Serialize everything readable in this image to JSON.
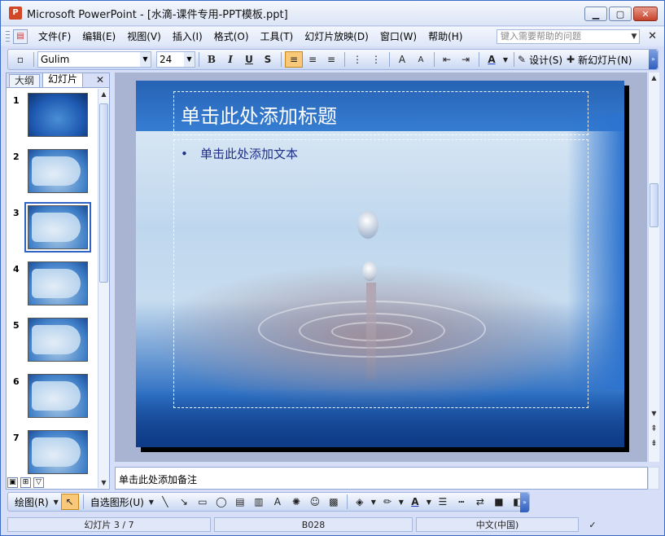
{
  "window": {
    "title": "Microsoft PowerPoint - [水滴-课件专用-PPT模板.ppt]",
    "icon_letter": "P"
  },
  "menu": {
    "items": [
      "文件(F)",
      "编辑(E)",
      "视图(V)",
      "插入(I)",
      "格式(O)",
      "工具(T)",
      "幻灯片放映(D)",
      "窗口(W)",
      "帮助(H)"
    ],
    "help_placeholder": "键入需要帮助的问题"
  },
  "toolbar": {
    "font": "Gulim",
    "size": "24",
    "bold": "B",
    "italic": "I",
    "underline": "U",
    "shadow": "S",
    "design_label": "设计(S)",
    "new_slide_label": "新幻灯片(N)"
  },
  "panel": {
    "tabs": [
      "大纲",
      "幻灯片"
    ],
    "slides": [
      {
        "n": "1"
      },
      {
        "n": "2"
      },
      {
        "n": "3",
        "selected": true
      },
      {
        "n": "4"
      },
      {
        "n": "5"
      },
      {
        "n": "6"
      },
      {
        "n": "7"
      }
    ]
  },
  "slide": {
    "title_placeholder": "单击此处添加标题",
    "body_placeholder": "单击此处添加文本",
    "bullet": "•"
  },
  "notes": {
    "placeholder": "单击此处添加备注"
  },
  "drawbar": {
    "draw_label": "绘图(R)",
    "autoshapes_label": "自选图形(U)"
  },
  "status": {
    "slide_of": "幻灯片 3 / 7",
    "design": "B028",
    "language": "中文(中国)"
  }
}
